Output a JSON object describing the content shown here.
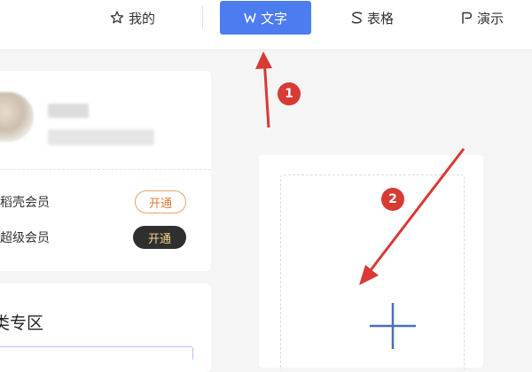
{
  "nav": {
    "mine_label": "我的",
    "text_label": "文字",
    "sheet_label": "表格",
    "slide_label": "演示",
    "active_color": "#4d7cf0"
  },
  "icons": {
    "mine": "star-icon",
    "text": "w-doc-icon",
    "sheet": "s-sheet-icon",
    "slide": "p-slide-icon",
    "new": "plus-icon"
  },
  "profile": {
    "members": [
      {
        "label": "稻壳会员",
        "action": "开通"
      },
      {
        "label": "超级会员",
        "action": "开通"
      }
    ]
  },
  "zone": {
    "title": "类专区"
  },
  "annotations": {
    "step1": "1",
    "step2": "2",
    "color": "#d83a34"
  }
}
